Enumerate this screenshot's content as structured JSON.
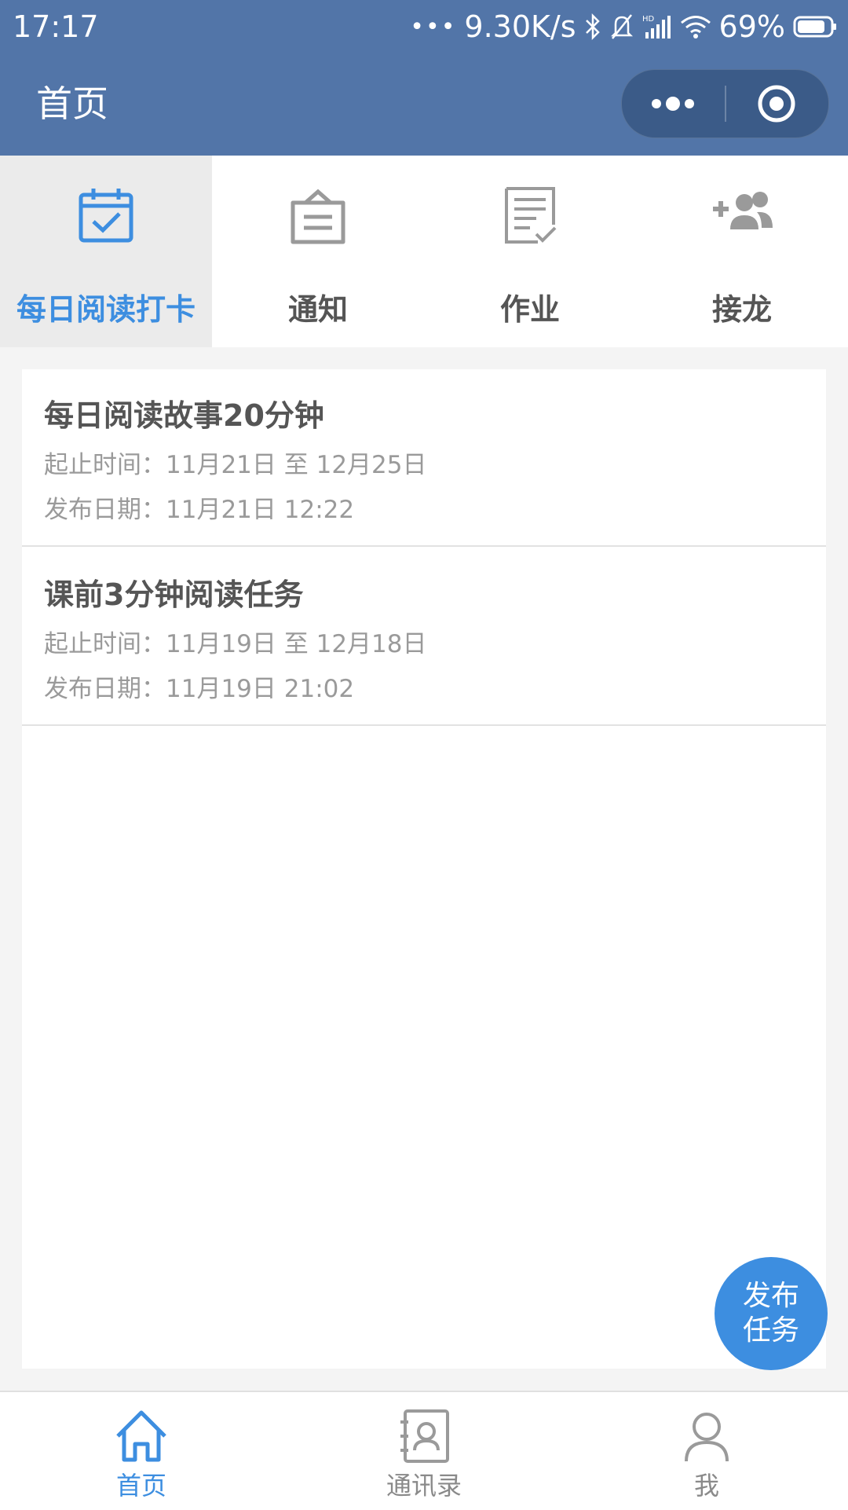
{
  "status_bar": {
    "time": "17:17",
    "network_speed": "9.30K/s",
    "battery": "69%"
  },
  "header": {
    "title": "首页"
  },
  "categories": [
    {
      "label": "每日阅读打卡",
      "icon": "calendar-check-icon",
      "active": true
    },
    {
      "label": "通知",
      "icon": "notice-board-icon",
      "active": false
    },
    {
      "label": "作业",
      "icon": "homework-list-icon",
      "active": false
    },
    {
      "label": "接龙",
      "icon": "add-users-icon",
      "active": false
    }
  ],
  "tasks": [
    {
      "title": "每日阅读故事20分钟",
      "period": "起止时间：11月21日 至 12月25日",
      "published": "发布日期：11月21日 12:22"
    },
    {
      "title": "课前3分钟阅读任务",
      "period": "起止时间：11月19日 至 12月18日",
      "published": "发布日期：11月19日 21:02"
    }
  ],
  "fab": {
    "line1": "发布",
    "line2": "任务"
  },
  "bottom_nav": [
    {
      "label": "首页",
      "icon": "home-icon",
      "active": true
    },
    {
      "label": "通讯录",
      "icon": "contacts-icon",
      "active": false
    },
    {
      "label": "我",
      "icon": "user-icon",
      "active": false
    }
  ],
  "colors": {
    "header_bg": "#5275a8",
    "accent": "#3d8ee0",
    "inactive_icon": "#9a9a9a"
  }
}
